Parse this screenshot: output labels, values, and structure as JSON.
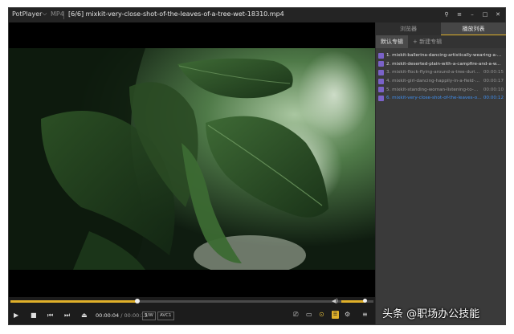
{
  "window": {
    "app_name": "PotPlayer",
    "format": "MP4",
    "title": "[6/6] mixkit-very-close-shot-of-the-leaves-of-a-tree-wet-18310.mp4"
  },
  "panel": {
    "tabs": [
      {
        "label": "浏览器",
        "active": false
      },
      {
        "label": "播放列表",
        "active": true
      }
    ],
    "subtabs": {
      "default": "默认专辑",
      "new": "+ 新建专辑"
    },
    "items": [
      {
        "name": "1. mixkit-ballerina-dancing-artistically-wearing-a-...",
        "duration": "",
        "state": "bright"
      },
      {
        "name": "2. mixkit-deserted-plain-with-a-campfire-and-a-w...",
        "duration": "",
        "state": "bright"
      },
      {
        "name": "3. mixkit-flock-flying-around-a-tree-durin...",
        "duration": "00:00:15",
        "state": "dim"
      },
      {
        "name": "4. mixkit-girl-dancing-happily-in-a-field-...",
        "duration": "00:00:17",
        "state": "dim"
      },
      {
        "name": "5. mixkit-standing-woman-listening-to-m...",
        "duration": "00:00:10",
        "state": "dim"
      },
      {
        "name": "6. mixkit-very-close-shot-of-the-leaves-of...",
        "duration": "00:00:12",
        "state": "current"
      }
    ]
  },
  "player": {
    "current_time": "00:00:04",
    "total_time": "00:00:12",
    "progress": 0.35,
    "volume": 0.85,
    "badges": [
      "S/W",
      "AVC1"
    ],
    "colors": {
      "accent": "#e0b02a",
      "current_item": "#3f8ff0"
    }
  },
  "watermark": "头条 @职场办公技能"
}
